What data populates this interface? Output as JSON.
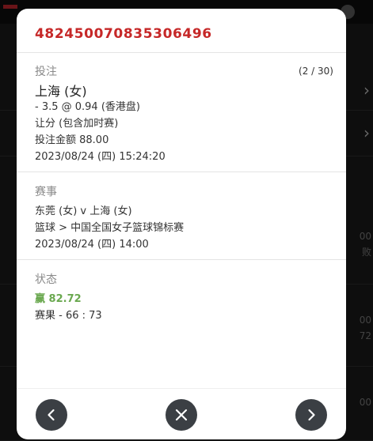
{
  "modal": {
    "bet_id": "482450070835306496",
    "counter": "(2 / 30)",
    "bet_section": {
      "label": "投注",
      "selection": "上海 (女)",
      "odds_line": "- 3.5 @ 0.94 (香港盘)",
      "market": "让分 (包含加时赛)",
      "stake": "投注金额 88.00",
      "placed_time": "2023/08/24 (四) 15:24:20"
    },
    "event_section": {
      "label": "赛事",
      "match": "东莞 (女) v 上海 (女)",
      "competition": "篮球 > 中国全国女子篮球锦标赛",
      "start_time": "2023/08/24 (四) 14:00"
    },
    "status_section": {
      "label": "状态",
      "result_icon_text": "赢",
      "payout": "82.72",
      "score": "赛果 - 66 : 73"
    },
    "buttons": {
      "prev": "chevron-left-icon",
      "close": "close-icon",
      "next": "chevron-right-icon"
    }
  },
  "background": {
    "side_texts": [
      "00",
      "败",
      "00",
      "72",
      "00"
    ]
  },
  "colors": {
    "title": "#c62828",
    "win": "#6aa84f",
    "button": "#3b3f44"
  }
}
